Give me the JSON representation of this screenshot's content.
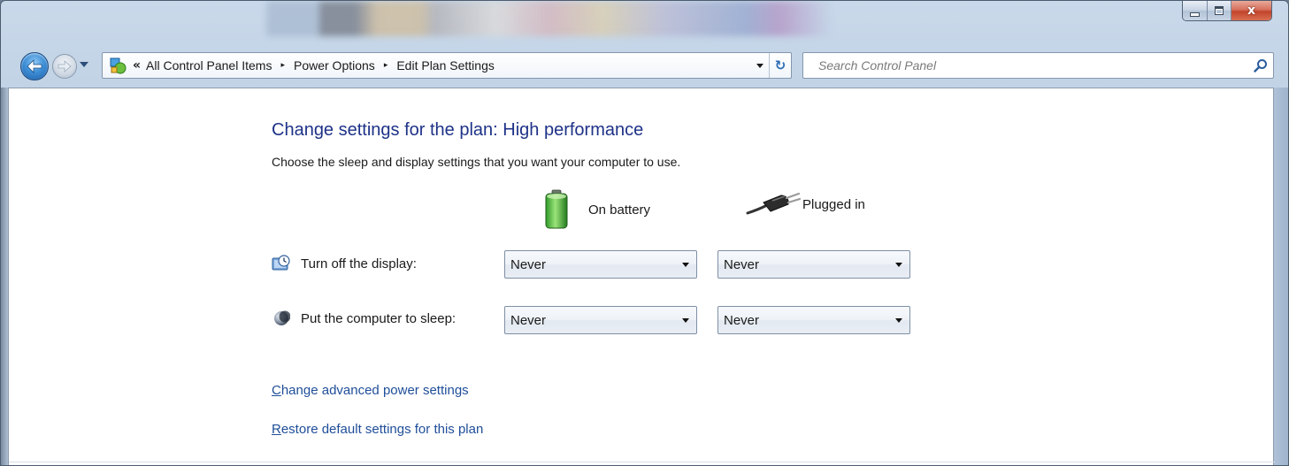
{
  "window": {
    "caption": {
      "minimize": "",
      "maximize": "",
      "close": "x"
    }
  },
  "navbar": {
    "breadcrumb_overflow": "«",
    "breadcrumbs": [
      "All Control Panel Items",
      "Power Options",
      "Edit Plan Settings"
    ],
    "breadcrumb_separator": "▸",
    "refresh_glyph": "↻",
    "search_placeholder": "Search Control Panel"
  },
  "page": {
    "title": "Change settings for the plan: High performance",
    "subtitle": "Choose the sleep and display settings that you want your computer to use.",
    "columns": {
      "battery": "On battery",
      "plugged": "Plugged in"
    },
    "settings": [
      {
        "label": "Turn off the display:",
        "on_battery": "Never",
        "plugged_in": "Never"
      },
      {
        "label": "Put the computer to sleep:",
        "on_battery": "Never",
        "plugged_in": "Never"
      }
    ],
    "links": {
      "advanced_first": "C",
      "advanced_rest": "hange advanced power settings",
      "restore_first": "R",
      "restore_rest": "estore default settings for this plan"
    }
  },
  "colors": {
    "title_blue": "#1e3287",
    "link_blue": "#1f4e99",
    "close_red": "#c2442b"
  },
  "icons": [
    "back-arrow-icon",
    "forward-arrow-icon",
    "control-panel-icon",
    "refresh-icon",
    "search-icon",
    "battery-icon",
    "power-plug-icon",
    "display-clock-icon",
    "sleep-moon-icon"
  ]
}
